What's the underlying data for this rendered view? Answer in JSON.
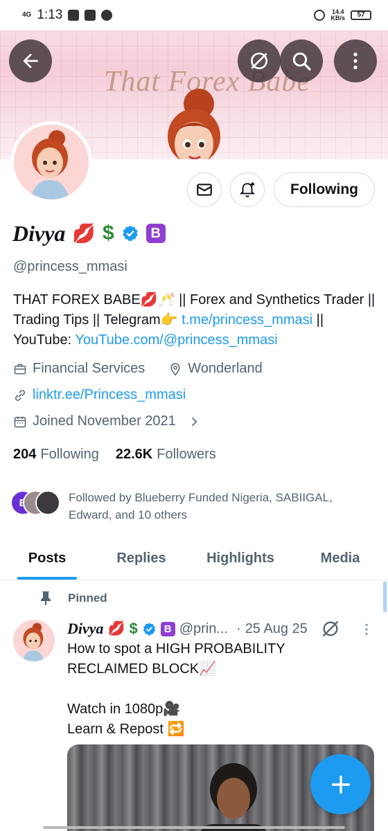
{
  "status_bar": {
    "network": "4G",
    "time": "1:13",
    "speed_value": "14.4",
    "speed_unit": "KB/s",
    "battery": "57"
  },
  "banner": {
    "brand_text": "That Forex Babe"
  },
  "profile": {
    "following_button": "Following",
    "display_name": "Divya",
    "name_emoji_lips": "💋",
    "name_emoji_dollar": "$",
    "b_badge": "B",
    "handle": "@princess_mmasi",
    "bio": {
      "line1": "THAT FOREX BABE💋🥂 || Forex and Synthetics Trader || Trading Tips || Telegram👉 ",
      "telegram_link": "t.me/princess_mmasi",
      "mid": " || YouTube: ",
      "youtube_link": "YouTube.com/@princess_mmasi"
    },
    "category": "Financial Services",
    "location": "Wonderland",
    "website": "linktr.ee/Princess_mmasi",
    "joined": "Joined November 2021",
    "following_count": "204",
    "following_label": "Following",
    "followers_count": "22.6K",
    "followers_label": "Followers",
    "followed_by": "Followed by Blueberry Funded Nigeria, SABIIGAL, Edward, and 10 others",
    "followed_by_badge": "B"
  },
  "tabs": [
    "Posts",
    "Replies",
    "Highlights",
    "Media"
  ],
  "pinned_post": {
    "pinned_label": "Pinned",
    "author_name": "Divya",
    "handle": "@prin...",
    "separator": "·",
    "date": "25 Aug 25",
    "body": "How to spot a HIGH PROBABILITY RECLAIMED BLOCK📈\n\nWatch in 1080p🎥\nLearn & Repost 🔁"
  },
  "colors": {
    "accent": "#1d9bf0",
    "text_primary": "#0f1419",
    "text_secondary": "#536471",
    "b_badge": "#8e3fd1",
    "banner_pink": "#f6cdd8"
  }
}
